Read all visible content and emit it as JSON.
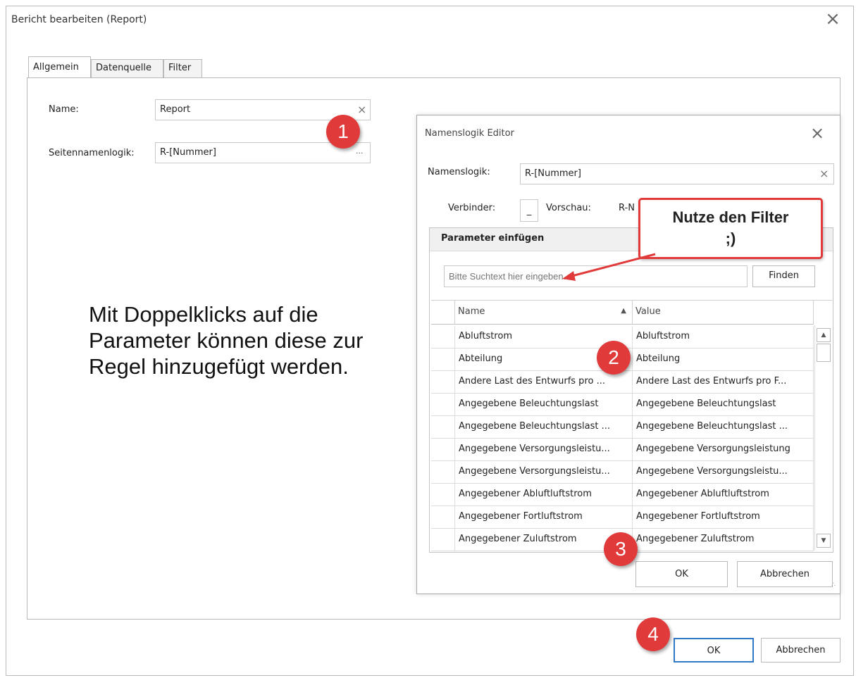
{
  "outer_dialog": {
    "title": "Bericht bearbeiten (Report)",
    "close_symbol": "×",
    "tabs": [
      {
        "label": "Allgemein",
        "active": true
      },
      {
        "label": "Datenquelle",
        "active": false
      },
      {
        "label": "Filter",
        "active": false
      }
    ],
    "name_label": "Name:",
    "name_value": "Report",
    "pagename_label": "Seitennamenlogik:",
    "pagename_value": "R-[Nummer]",
    "ellipsis": "...",
    "ok_label": "OK",
    "cancel_label": "Abbrechen"
  },
  "instruction_text": "Mit Doppelklicks auf die Parameter können diese zur Regel hinzugefügt werden.",
  "inner_dialog": {
    "title": "Namenslogik Editor",
    "close_symbol": "×",
    "logic_label": "Namenslogik:",
    "logic_value": "R-[Nummer]",
    "connector_label": "Verbinder:",
    "connector_value": "_",
    "preview_label": "Vorschau:",
    "preview_value": "R-N",
    "param_header": "Parameter einfügen",
    "search_placeholder": "Bitte Suchtext hier eingeben...",
    "find_label": "Finden",
    "columns": {
      "name": "Name",
      "value": "Value"
    },
    "sort_indicator": "▲",
    "rows": [
      {
        "name": "Abluftstrom",
        "value": "Abluftstrom"
      },
      {
        "name": "Abteilung",
        "value": "Abteilung"
      },
      {
        "name": "Andere Last des Entwurfs pro ...",
        "value": "Andere Last des Entwurfs pro F..."
      },
      {
        "name": "Angegebene Beleuchtungslast",
        "value": "Angegebene Beleuchtungslast"
      },
      {
        "name": "Angegebene Beleuchtungslast ...",
        "value": "Angegebene Beleuchtungslast ..."
      },
      {
        "name": "Angegebene Versorgungsleistu...",
        "value": "Angegebene Versorgungsleistung"
      },
      {
        "name": "Angegebene Versorgungsleistu...",
        "value": "Angegebene Versorgungsleistu..."
      },
      {
        "name": "Angegebener Abluftluftstrom",
        "value": "Angegebener Abluftluftstrom"
      },
      {
        "name": "Angegebener Fortluftstrom",
        "value": "Angegebener Fortluftstrom"
      },
      {
        "name": "Angegebener Zuluftstrom",
        "value": "Angegebener Zuluftstrom"
      }
    ],
    "ok_label": "OK",
    "cancel_label": "Abbrechen"
  },
  "annotations": {
    "badges": [
      "1",
      "2",
      "3",
      "4"
    ],
    "callout_line1": "Nutze den Filter",
    "callout_line2": ";)",
    "color": "#e03a3a"
  },
  "colors": {
    "primary_button_border": "#2f78c5"
  }
}
